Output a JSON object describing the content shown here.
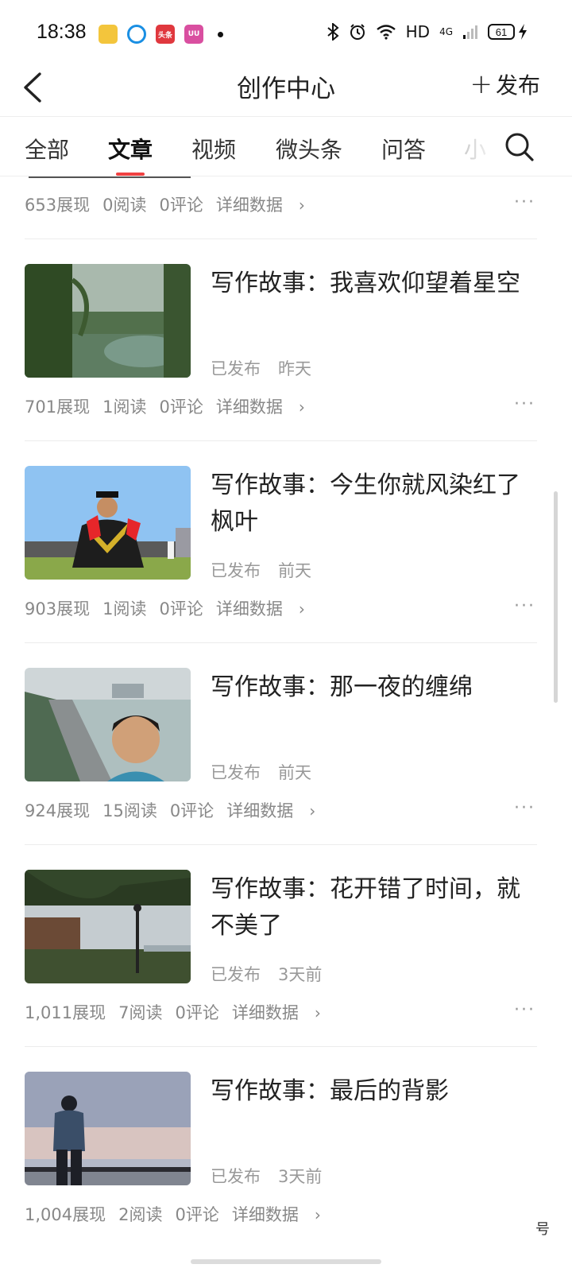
{
  "status_bar": {
    "time": "18:38",
    "network": "HD",
    "signal_label": "4G",
    "battery": "61",
    "app_badges": [
      "头条",
      "UU"
    ]
  },
  "header": {
    "title": "创作中心",
    "publish_label": "发布"
  },
  "tabs": [
    {
      "label": "全部",
      "active": false
    },
    {
      "label": "文章",
      "active": true
    },
    {
      "label": "视频",
      "active": false
    },
    {
      "label": "微头条",
      "active": false
    },
    {
      "label": "问答",
      "active": false
    },
    {
      "label": "小",
      "active": false
    }
  ],
  "accent_color": "#f04142",
  "top_partial_stats": {
    "impressions": "653展现",
    "reads": "0阅读",
    "comments": "0评论",
    "detail": "详细数据"
  },
  "articles": [
    {
      "title": "写作故事：我喜欢仰望着星空",
      "status": "已发布",
      "date": "昨天",
      "impressions": "701展现",
      "reads": "1阅读",
      "comments": "0评论",
      "detail": "详细数据"
    },
    {
      "title": "写作故事：今生你就风染红了枫叶",
      "status": "已发布",
      "date": "前天",
      "impressions": "903展现",
      "reads": "1阅读",
      "comments": "0评论",
      "detail": "详细数据"
    },
    {
      "title": "写作故事：那一夜的缠绵",
      "status": "已发布",
      "date": "前天",
      "impressions": "924展现",
      "reads": "15阅读",
      "comments": "0评论",
      "detail": "详细数据"
    },
    {
      "title": "写作故事：花开错了时间，就不美了",
      "status": "已发布",
      "date": "3天前",
      "impressions": "1,011展现",
      "reads": "7阅读",
      "comments": "0评论",
      "detail": "详细数据"
    },
    {
      "title": "写作故事：最后的背影",
      "status": "已发布",
      "date": "3天前",
      "impressions": "1,004展现",
      "reads": "2阅读",
      "comments": "0评论",
      "detail": "详细数据"
    }
  ],
  "more_label": "···",
  "chevron": "›",
  "corner_text": "号"
}
